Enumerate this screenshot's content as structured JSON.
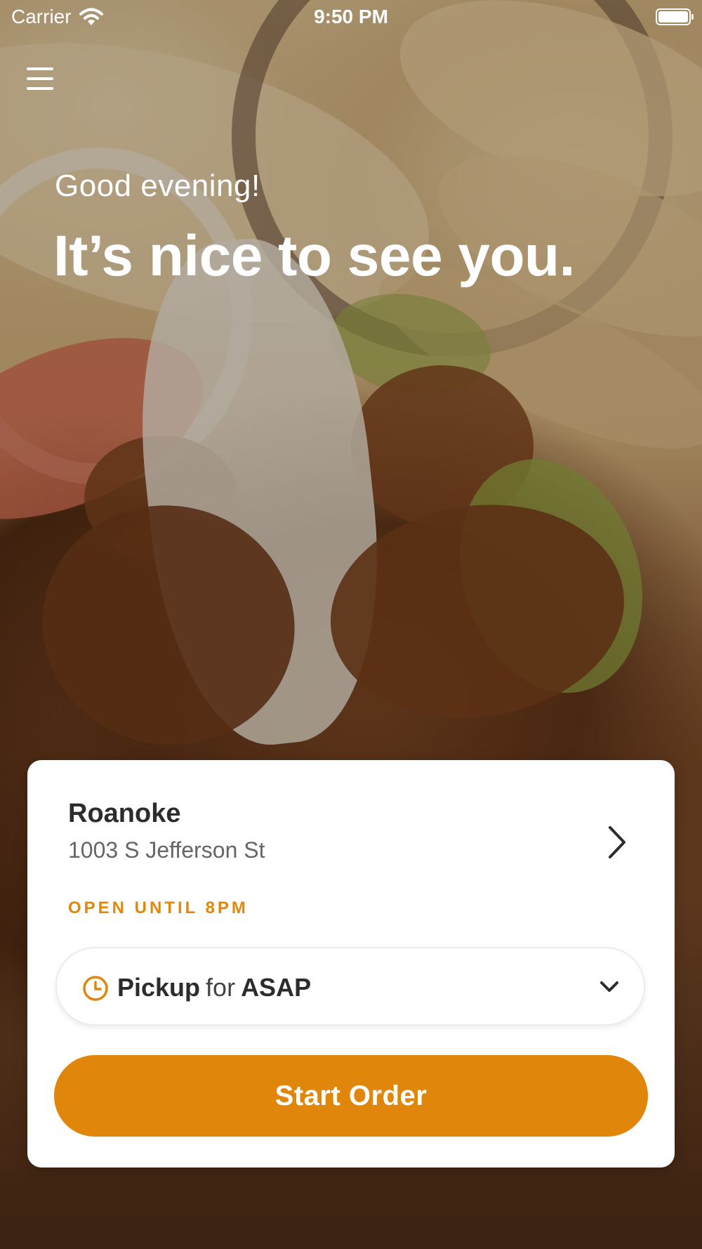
{
  "status_bar": {
    "carrier": "Carrier",
    "time": "9:50 PM",
    "wifi_icon": "wifi-icon",
    "battery_icon": "battery-icon"
  },
  "header": {
    "menu_icon": "hamburger-menu-icon"
  },
  "hero": {
    "greeting": "Good evening!",
    "headline": "It’s nice to see you."
  },
  "location": {
    "name": "Roanoke",
    "address": "1003 S Jefferson St",
    "hours_status": "OPEN UNTIL 8PM"
  },
  "order_mode": {
    "mode": "Pickup",
    "connector": "for",
    "time": "ASAP"
  },
  "actions": {
    "start_order_label": "Start Order"
  },
  "colors": {
    "accent": "#e0860b",
    "text_dark": "#2c2c2c",
    "text_muted": "#666666"
  }
}
